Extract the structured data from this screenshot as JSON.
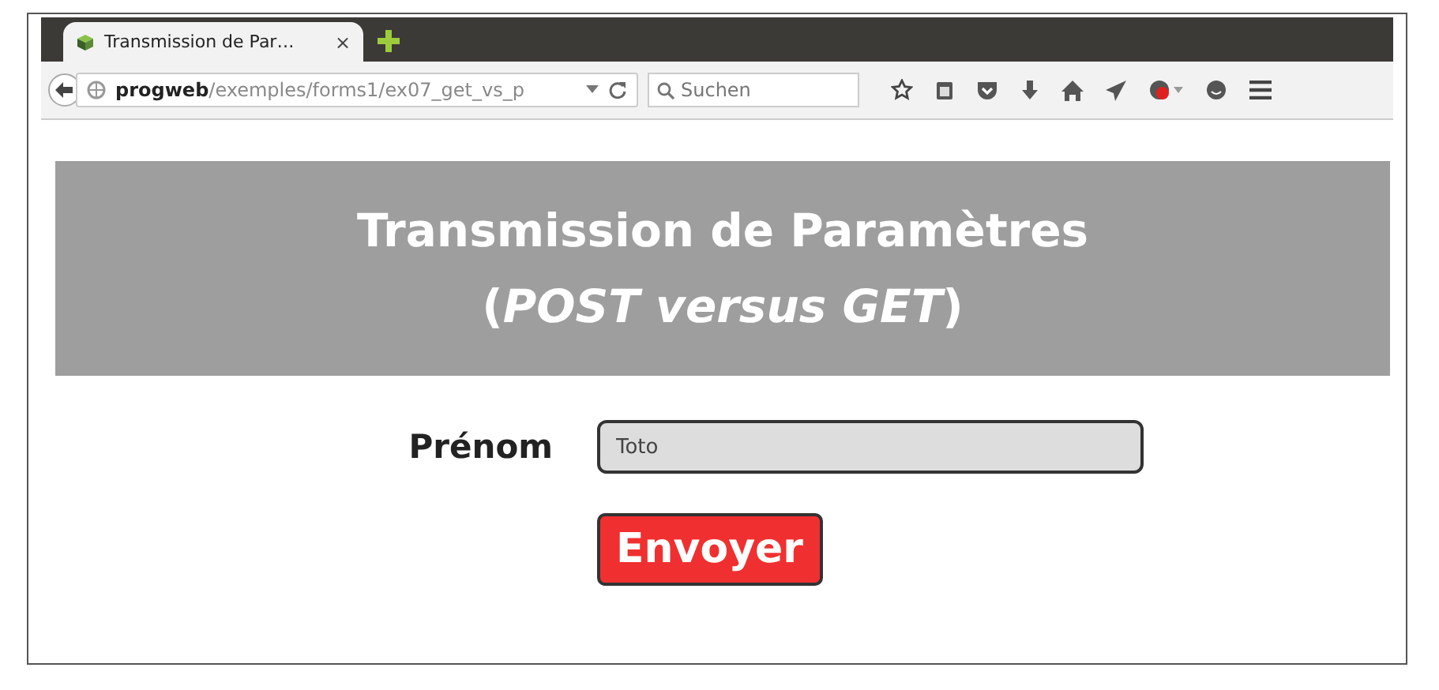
{
  "browser": {
    "tab": {
      "title": "Transmission de Par…",
      "close": "×"
    },
    "url": {
      "host": "progweb",
      "path": "/exemples/forms1/ex07_get_vs_p"
    },
    "search": {
      "placeholder": "Suchen"
    }
  },
  "banner": {
    "lines": [
      "Transmission de Paramètres",
      "(*POST versus GET*)"
    ]
  },
  "form": {
    "label": "Prénom",
    "value": "Toto",
    "submit": "Envoyer"
  }
}
